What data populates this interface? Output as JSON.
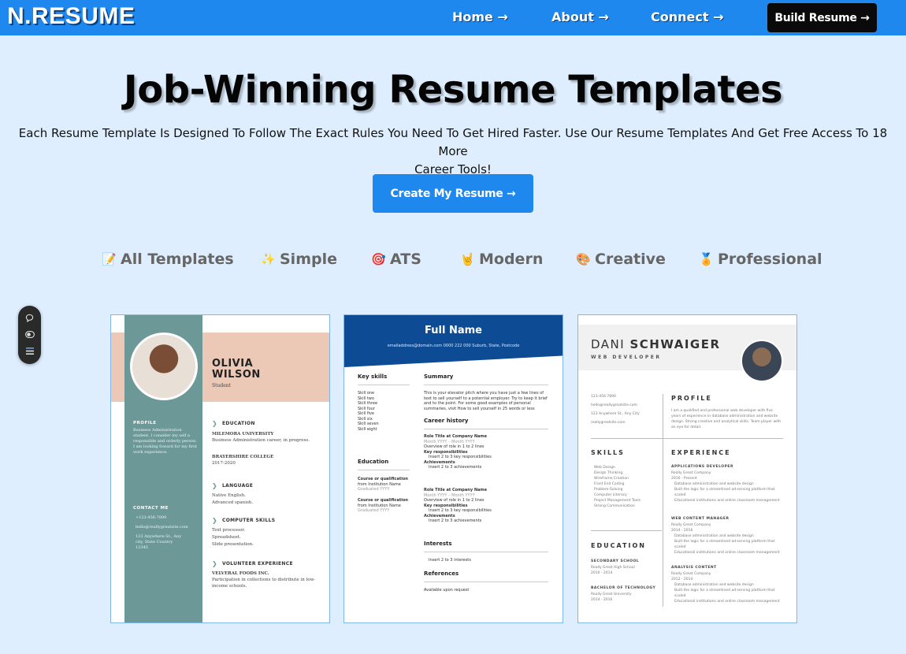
{
  "brand": {
    "logo": "N.RESUME"
  },
  "nav": {
    "links": [
      "Home →",
      "About →",
      "Connect →"
    ],
    "cta": "Build Resume →"
  },
  "hero": {
    "title": "Job-Winning Resume Templates",
    "subtitle_line1": "Each Resume Template Is Designed To Follow The Exact Rules You Need To Get Hired Faster. Use Our Resume Templates And Get Free Access To 18 More",
    "subtitle_line2": "Career Tools!",
    "cta": "Create My Resume →"
  },
  "filters": [
    {
      "icon": "📝",
      "label": "All Templates"
    },
    {
      "icon": "✨",
      "label": "Simple"
    },
    {
      "icon": "🎯",
      "label": "ATS"
    },
    {
      "icon": "🤘",
      "label": "Modern"
    },
    {
      "icon": "🎨",
      "label": "Creative"
    },
    {
      "icon": "🏅",
      "label": "Professional"
    }
  ],
  "templates": {
    "t1": {
      "first": "OLIVIA",
      "last": "WILSON",
      "role": "Student",
      "profile_h": "PROFILE",
      "profile": "Business Administration student. I consider my self a responsible and orderly person. I am looking foward for my first work experience.",
      "contact_h": "CONTACT ME",
      "phone": "+123-456-7890",
      "email": "hello@reallygreatsite.com",
      "address": "123 Anywhere St., Any city, State Country 12345",
      "edu_h": "EDUCATION",
      "edu1": "MILEMORA UNIVERSITY",
      "edu1_d": "Business Administration career, in progress.",
      "edu2": "BRAYERSHIRE COLLEGE",
      "edu2_d": "2017-2020",
      "lang_h": "LANGUAGE",
      "lang": "Native English.",
      "lang2": "Advanced spanish.",
      "skills_h": "COMPUTER SKILLS",
      "skill1": "Text processor.",
      "skill2": "Spreadsheet.",
      "skill3": "Slide presentation.",
      "vol_h": "VOLUNTEER EXPERIENCE",
      "vol": "VELVERAL FOODS INC.",
      "vol_d": "Participation in collections to distribute in low-income schools."
    },
    "t2": {
      "name": "Full Name",
      "contact": "emailaddress@domain.com      0000 222 000      Suburb, State, Postcode",
      "key_h": "Key skills",
      "skills": [
        "Skill one",
        "Skill two",
        "Skill three",
        "Skill four",
        "Skill five",
        "Skill six",
        "Skill seven",
        "Skill eight"
      ],
      "edu_h": "Education",
      "edu1": "Course or qualification",
      "edu1b": "from Institution Name",
      "edu1c": "Graduated YYYY",
      "edu2": "Course or qualification",
      "edu2b": "from Institution Name",
      "edu2c": "Graduated YYYY",
      "summary_h": "Summary",
      "summary": "This is your elevator pitch where you have just a few lines of text to sell yourself to a potential employer. Try to keep it brief and to the point. For some good examples of personal summaries, visit How to sell yourself in 25 words or less",
      "career_h": "Career history",
      "job1": "Role Title at Company Name",
      "job1d": "Month YYYY – Month YYYY",
      "job1o": "Overview of role in 1 to 2 lines",
      "job1r": "Key responsibilities",
      "job1rb": "Insert 2 to 3 key responsibilities",
      "job1a": "Achievements",
      "job1ab": "Insert 2 to 3 achievements",
      "job2": "Role Title at Company Name",
      "job2d": "Month YYYY – Month YYYY",
      "job2o": "Overview of role in 1 to 2 lines",
      "job2r": "Key responsibilities",
      "job2rb": "Insert 2 to 3 key responsibilities",
      "job2a": "Achievements",
      "job2ab": "Insert 2 to 3 achievements",
      "int_h": "Interests",
      "int": "Insert 2 to 3 interests",
      "ref_h": "References",
      "ref": "Available upon request"
    },
    "t3": {
      "first": "DANI",
      "last": "SCHWAIGER",
      "job": "WEB DEVELOPER",
      "phone": "123-456-7890",
      "email": "hello@reallygreatsite.com",
      "address": "123 Anywhere St., Any City",
      "site": "reallygreatsite.com",
      "profile_h": "PROFILE",
      "profile": "I am a qualified and professional web developer with five years of experience in database administration and website design. Strong creative and analytical skills. Team player with an eye for detail.",
      "skills_h": "SKILLS",
      "skills": [
        "Web Design",
        "Design Thinking",
        "Wireframe Creation",
        "Front End Coding",
        "Problem-Solving",
        "Computer Literacy",
        "Project Management Tools",
        "Strong Communication"
      ],
      "exp_h": "EXPERIENCE",
      "exp1": "APPLICATIONS DEVELOPER",
      "exp1c": "Really Great Company",
      "exp1d": "2016 - Present",
      "exp2": "WEB CONTENT MANAGER",
      "exp2c": "Really Great Company",
      "exp2d": "2014 - 2016",
      "exp3": "ANALYSIS CONTENT",
      "exp3c": "Really Great Company",
      "exp3d": "2012 - 2014",
      "bullet1": "Database administration and website design",
      "bullet2": "Built the logic for a streamlined ad-serving platform that scaled",
      "bullet3": "Educational institutions and online classroom management",
      "edu_h": "EDUCATION",
      "edu1": "SECONDARY SCHOOL",
      "edu1s": "Really Great High School",
      "edu1d": "2010 - 2014",
      "edu2": "BACHELOR OF TECHNOLOGY",
      "edu2s": "Really Great University",
      "edu2d": "2014 - 2016"
    }
  }
}
